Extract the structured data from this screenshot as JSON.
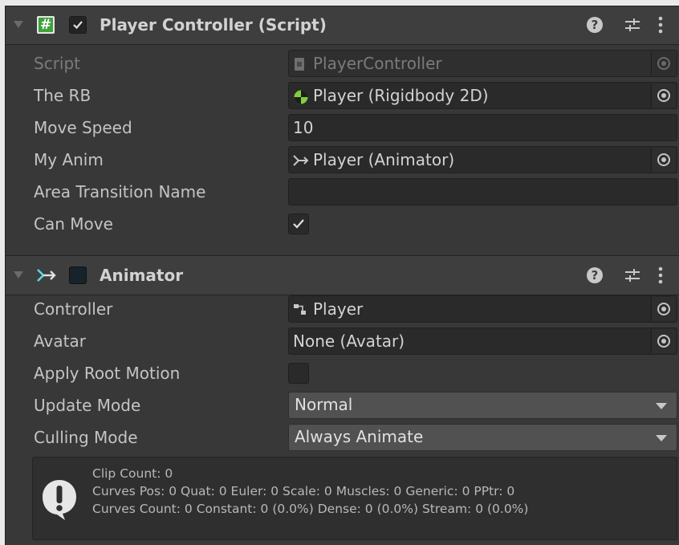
{
  "components": [
    {
      "title": "Player Controller (Script)",
      "enabled": true,
      "fields": [
        {
          "label": "Script",
          "value": "PlayerController",
          "type": "object-readonly",
          "icon": "script-file-icon"
        },
        {
          "label": "The RB",
          "value": "Player (Rigidbody 2D)",
          "type": "object",
          "icon": "rigidbody2d-icon"
        },
        {
          "label": "Move Speed",
          "value": "10",
          "type": "number"
        },
        {
          "label": "My Anim",
          "value": "Player (Animator)",
          "type": "object",
          "icon": "animator-icon"
        },
        {
          "label": "Area Transition Name",
          "value": "",
          "type": "text"
        },
        {
          "label": "Can Move",
          "value": true,
          "type": "checkbox"
        }
      ]
    },
    {
      "title": "Animator",
      "enabled": false,
      "fields": [
        {
          "label": "Controller",
          "value": "Player",
          "type": "object",
          "icon": "animator-controller-icon"
        },
        {
          "label": "Avatar",
          "value": "None (Avatar)",
          "type": "object"
        },
        {
          "label": "Apply Root Motion",
          "value": false,
          "type": "checkbox"
        },
        {
          "label": "Update Mode",
          "value": "Normal",
          "type": "dropdown"
        },
        {
          "label": "Culling Mode",
          "value": "Always Animate",
          "type": "dropdown"
        }
      ]
    }
  ],
  "info_box": {
    "icon": "info-exclamation-icon",
    "lines": [
      "Clip Count: 0",
      "Curves Pos: 0 Quat: 0 Euler: 0 Scale: 0 Muscles: 0 Generic: 0 PPtr: 0",
      "Curves Count: 0 Constant: 0 (0.0%) Dense: 0 (0.0%) Stream: 0 (0.0%)"
    ]
  },
  "colors": {
    "panel_bg": "#383838",
    "header_bg": "#3e3e3e",
    "field_bg": "#2a2a2a",
    "dropdown_bg": "#515151",
    "text": "#c4c4c4",
    "script_icon": "#3fa33c",
    "animator_icon": "#5fd6e0"
  }
}
